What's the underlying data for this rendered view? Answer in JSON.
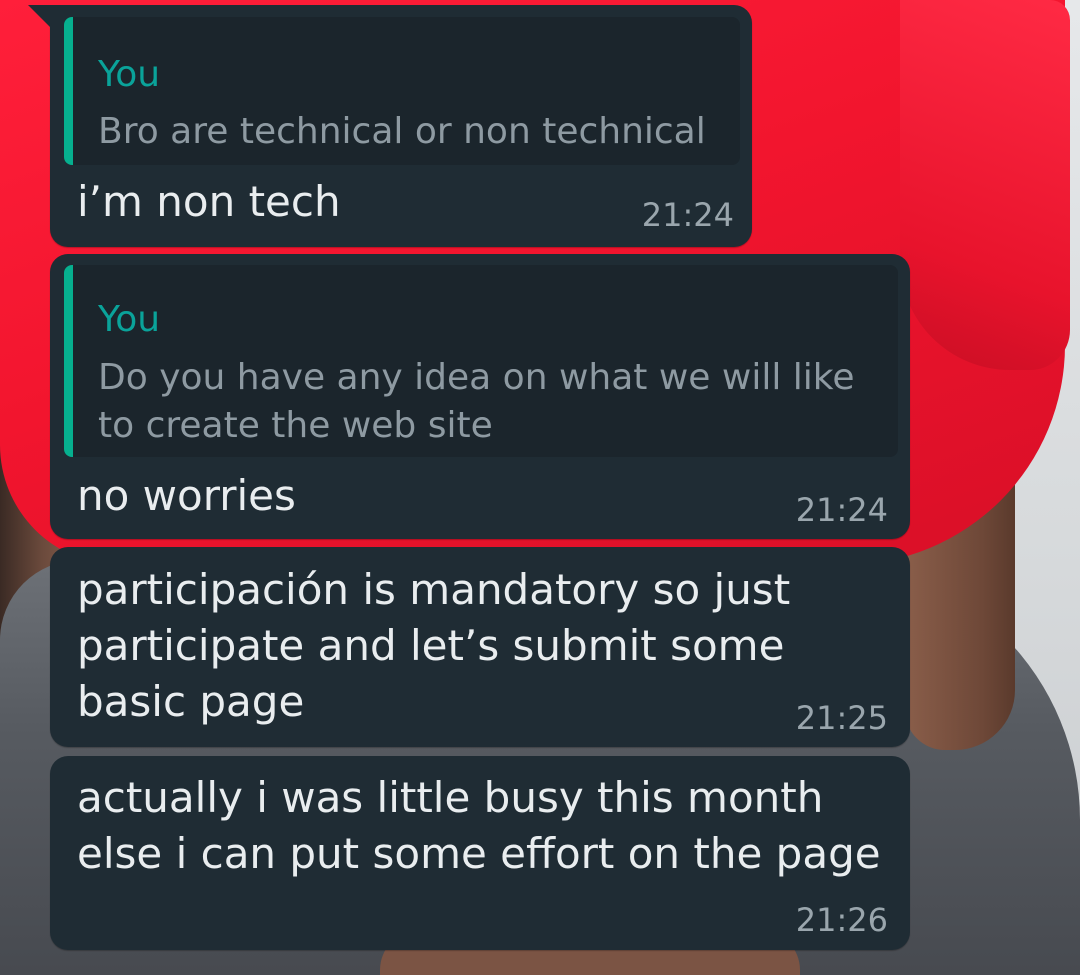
{
  "messages": [
    {
      "quote": {
        "author": "You",
        "text": "Bro are technical or non technical"
      },
      "text": "i’m non tech",
      "time": "21:24"
    },
    {
      "quote": {
        "author": "You",
        "text": "Do you have any idea on what we will like\nto create the web site"
      },
      "text": "no worries",
      "time": "21:24"
    },
    {
      "text": "participación is mandatory so just\nparticipate and let’s submit some\nbasic page",
      "time": "21:25"
    },
    {
      "text": "actually i was little busy this month\nelse i can put some effort on the page",
      "time": "21:26"
    }
  ],
  "colors": {
    "bubble": "#1f2c34",
    "quote_bar": "#06b08f",
    "quote_author": "#0aa39a",
    "text": "#e9edef",
    "timestamp": "#9aa6ad"
  }
}
